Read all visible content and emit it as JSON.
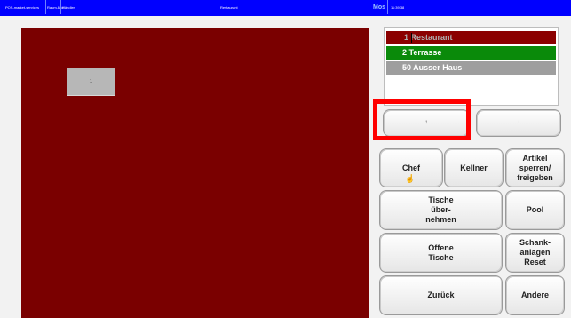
{
  "topbar": {
    "item1": "POS-market-services",
    "item2": "Raum-Bild",
    "item3": "Händler",
    "room": "Restaurant",
    "logo": "Mos",
    "time": "11:39:38"
  },
  "floor": {
    "tables": [
      {
        "label": "1"
      }
    ]
  },
  "areas": [
    {
      "label": "1 Restaurant",
      "color": "#8b0000"
    },
    {
      "label": "2 Terrasse",
      "color": "#0a8a0a"
    },
    {
      "label": "50 Ausser Haus",
      "color": "#9e9e9e"
    }
  ],
  "nav": {
    "up": "↑",
    "down": "↓"
  },
  "buttons": {
    "chef": "Chef",
    "kellner": "Kellner",
    "artikel": "Artikel sperren/ freigeben",
    "tische": "Tische über- nehmen",
    "pool": "Pool",
    "offene": "Offene Tische",
    "schank": "Schank- anlagen Reset",
    "zurueck": "Zurück",
    "andere": "Andere"
  },
  "colors": {
    "topbar": "#0000ff",
    "floor": "#7a0000",
    "highlight": "#ff0000"
  }
}
